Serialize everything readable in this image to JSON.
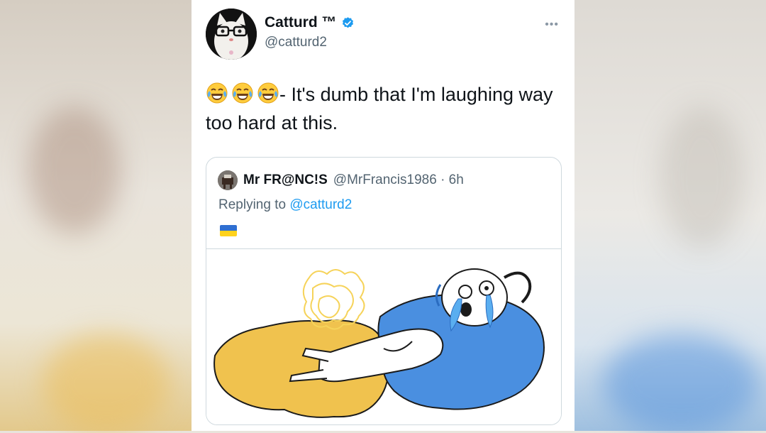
{
  "tweet": {
    "display_name": "Catturd ™",
    "handle": "@catturd2",
    "more_label": "•••",
    "emojis": [
      "face-with-tears-of-joy",
      "face-with-tears-of-joy",
      "face-with-tears-of-joy"
    ],
    "text": "- It's dumb that I'm laughing way too hard at this."
  },
  "quote": {
    "display_name": "Mr FR@NC!S",
    "handle_time": "@MrFrancis1986 · 6h",
    "replying_prefix": "Replying to",
    "replying_mention": "@catturd2",
    "flag": "ukraine-flag",
    "image": "meme-crying-stick-figure-lying-in-blue-and-yellow-puddle"
  },
  "colors": {
    "verified": "#1d9bf0",
    "link": "#1d9bf0",
    "flag_blue": "#2f6fd1",
    "flag_yellow": "#ffd21c",
    "meme_blue": "#4a8fe0",
    "meme_yellow": "#f0c24e"
  }
}
